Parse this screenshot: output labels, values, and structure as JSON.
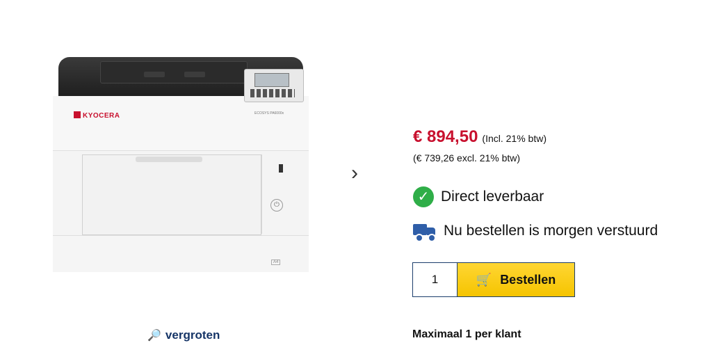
{
  "product": {
    "brand_logo": "KYOCERA",
    "model_label": "ECOSYS PA6000x",
    "tray_label": "A4"
  },
  "gallery": {
    "enlarge_label": "vergroten",
    "next_icon": "chevron-right-icon"
  },
  "pricing": {
    "price": "€ 894,50",
    "incl_vat": "(Incl. 21% btw)",
    "excl_vat": "(€ 739,26 excl. 21% btw)",
    "price_color": "#c8102e"
  },
  "availability": {
    "stock_text": "Direct leverbaar",
    "shipping_text": "Nu bestellen is morgen verstuurd",
    "stock_color": "#2fae48",
    "shipping_color": "#2f5ea8"
  },
  "order": {
    "quantity": "1",
    "button_label": "Bestellen",
    "button_color": "#f5c400",
    "limit_text": "Maximaal 1 per klant"
  }
}
